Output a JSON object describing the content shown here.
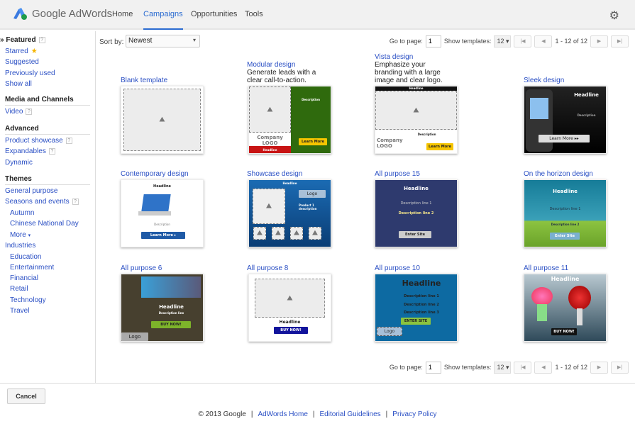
{
  "header": {
    "brand": "Google AdWords",
    "nav": [
      "Home",
      "Campaigns",
      "Opportunities",
      "Tools"
    ],
    "active": "Campaigns"
  },
  "sidebar": {
    "featured": "Featured",
    "starred": "Starred",
    "suggested": "Suggested",
    "previously_used": "Previously used",
    "show_all": "Show all",
    "media_heading": "Media and Channels",
    "video": "Video",
    "advanced_heading": "Advanced",
    "product_showcase": "Product showcase",
    "expandables": "Expandables",
    "dynamic": "Dynamic",
    "themes_heading": "Themes",
    "general_purpose": "General purpose",
    "seasons": "Seasons and events",
    "autumn": "Autumn",
    "chinese_national_day": "Chinese National Day",
    "more": "More",
    "industries": "Industries",
    "industry_items": [
      "Education",
      "Entertainment",
      "Financial",
      "Retail",
      "Technology",
      "Travel"
    ],
    "help": "?"
  },
  "toolbar": {
    "sort_label": "Sort by:",
    "sort_value": "Newest",
    "goto_label": "Go to page:",
    "page": "1",
    "show_label": "Show templates:",
    "show_value": "12",
    "range": "1 - 12 of 12"
  },
  "templates": [
    {
      "title": "Blank template",
      "desc": "",
      "style": "blank"
    },
    {
      "title": "Modular design",
      "desc": "Generate leads with a clear call-to-action.",
      "style": "modular",
      "texts": [
        "Description",
        "Company LOGO",
        "Headline",
        "Learn More"
      ]
    },
    {
      "title": "Vista design",
      "desc": "Emphasize your branding with a large image and clear logo.",
      "style": "vista",
      "texts": [
        "Headline",
        "Description",
        "Company LOGO",
        "Learn More"
      ]
    },
    {
      "title": "Sleek design",
      "desc": "",
      "style": "sleek",
      "texts": [
        "Headline",
        "Description",
        "Learn More ▸▸"
      ]
    },
    {
      "title": "Contemporary design",
      "desc": "",
      "style": "contemporary",
      "texts": [
        "Headline",
        "Description",
        "Learn More ▸"
      ]
    },
    {
      "title": "Showcase design",
      "desc": "",
      "style": "showcase",
      "texts": [
        "Headline",
        "Logo",
        "Product 1 description"
      ]
    },
    {
      "title": "All purpose 15",
      "desc": "",
      "style": "ap15",
      "texts": [
        "Headline",
        "Description line 1",
        "Description line 2",
        "Enter Site"
      ]
    },
    {
      "title": "On the horizon design",
      "desc": "",
      "style": "horizon",
      "texts": [
        "Headline",
        "Description line 1",
        "Description line 2",
        "Enter Site"
      ]
    },
    {
      "title": "All purpose 6",
      "desc": "",
      "style": "ap6",
      "texts": [
        "Headline",
        "Description line",
        "BUY NOW!",
        "Logo"
      ]
    },
    {
      "title": "All purpose 8",
      "desc": "",
      "style": "ap8",
      "texts": [
        "Headline",
        "BUY NOW!"
      ]
    },
    {
      "title": "All purpose 10",
      "desc": "",
      "style": "ap10",
      "texts": [
        "Headline",
        "Description line 1",
        "Description line 2",
        "Description line 3",
        "ENTER SITE",
        "Logo"
      ]
    },
    {
      "title": "All purpose 11",
      "desc": "",
      "style": "ap11",
      "texts": [
        "Headline",
        "BUY NOW!"
      ]
    }
  ],
  "footer": {
    "copyright": "© 2013 Google",
    "links": [
      "AdWords Home",
      "Editorial Guidelines",
      "Privacy Policy"
    ]
  },
  "cancel_label": "Cancel"
}
